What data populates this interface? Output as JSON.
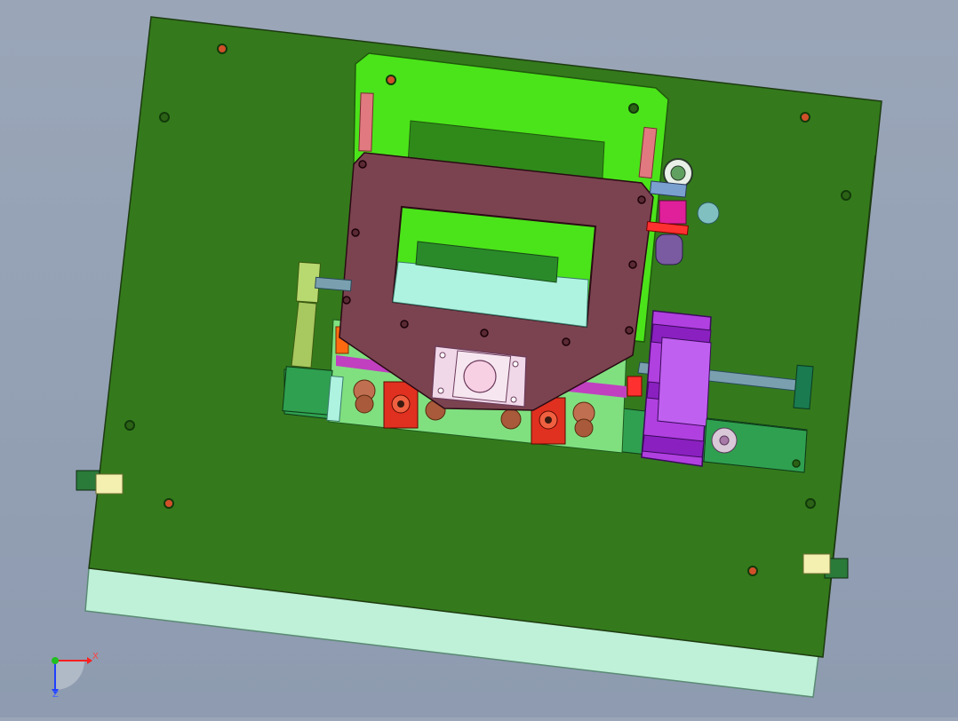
{
  "window": {
    "background_top": "#9aa6b8",
    "background_bottom": "#8e9bb0"
  },
  "triad": {
    "x_label": "X",
    "z_label": "Z",
    "x_color": "#ff2020",
    "z_color": "#2040ff",
    "origin_color": "#20c020"
  },
  "colors": {
    "base_plate": "#347a1c",
    "base_plate_edge": "#1d3a10",
    "front_panel": "#bff0d8",
    "carriage_plate": "#4be41a",
    "moving_plate": "#7b4350",
    "rail_block": "#2fa050",
    "drum": "#9a2ad8",
    "fixture": "#e03020",
    "valve": "#e0209a",
    "shaft": "#7aa0b0",
    "pink_rail": "#e07a80",
    "screw_red": "#d0502a",
    "screw_dark": "#123a0a"
  },
  "parts": [
    "base-plate",
    "front-panel",
    "carriage-plate",
    "moving-plate",
    "left-rail-block",
    "right-rail-block",
    "drum-assembly",
    "valve-assembly",
    "fixture-block",
    "side-handle-left",
    "side-handle-right"
  ]
}
